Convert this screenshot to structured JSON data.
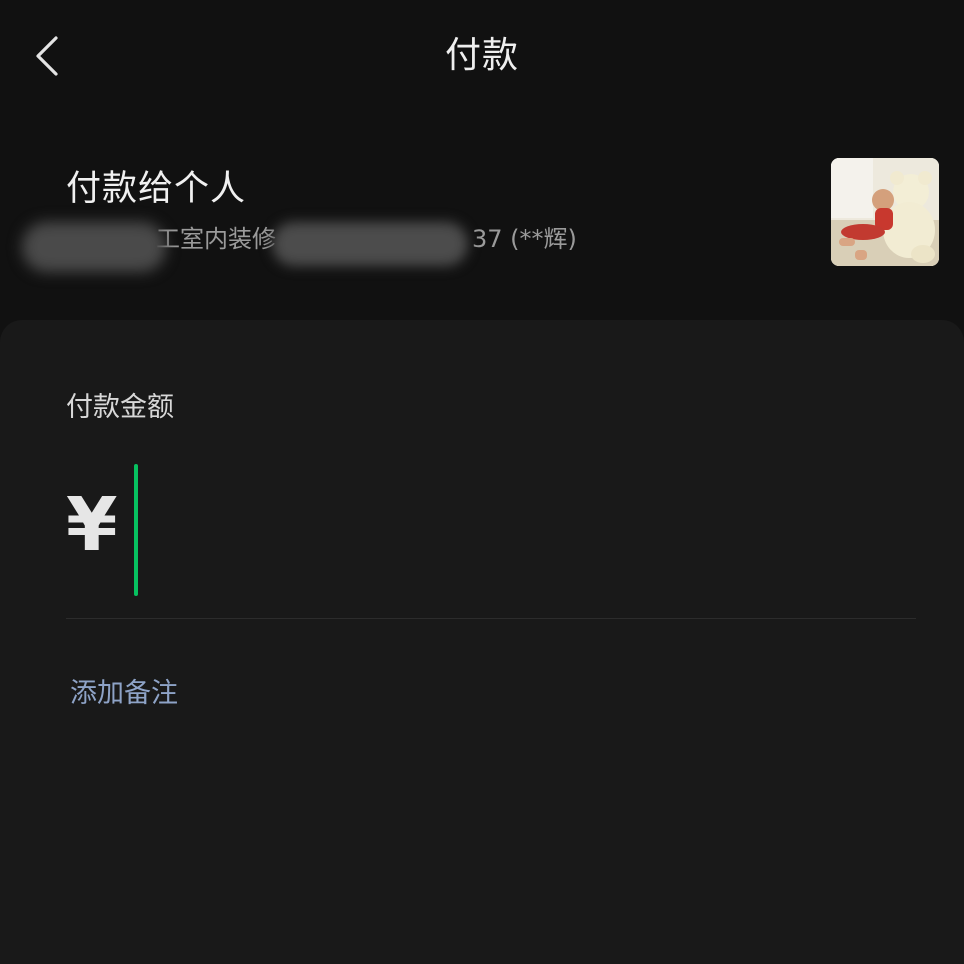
{
  "header": {
    "title": "付款",
    "back_icon": "chevron-left-icon"
  },
  "payee": {
    "heading": "付款给个人",
    "merchant_masked": "工室内装修",
    "id_suffix": "37 (**辉)",
    "avatar_icon": "user-avatar-photo"
  },
  "payment": {
    "amount_label": "付款金额",
    "currency_symbol": "¥",
    "amount_value": "",
    "add_note_label": "添加备注"
  },
  "colors": {
    "background": "#111111",
    "panel": "#191919",
    "caret": "#07c160",
    "link": "#8ea3c7"
  }
}
